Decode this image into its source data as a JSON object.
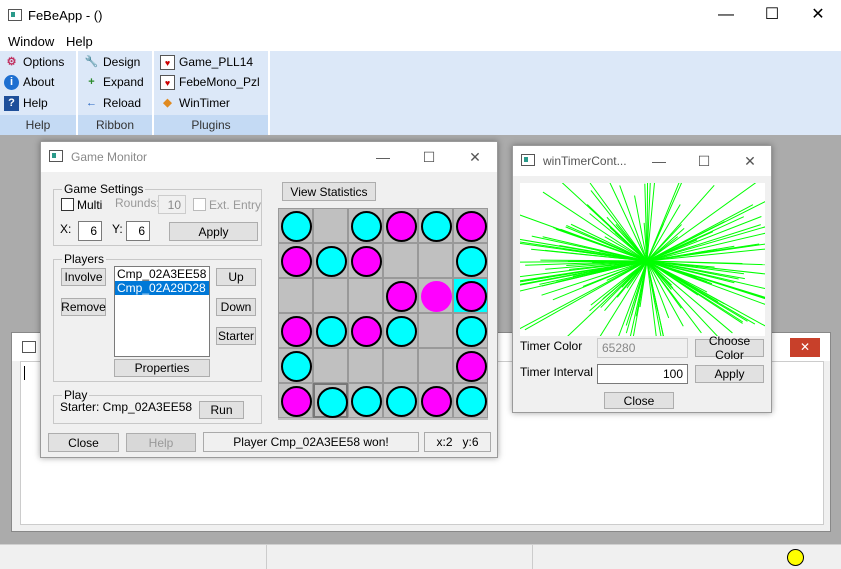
{
  "window": {
    "title": "FeBeApp -  ()",
    "minimize": "—",
    "maximize": "☐",
    "close": "✕"
  },
  "menu": {
    "window": "Window",
    "help": "Help"
  },
  "ribbon": {
    "groups": [
      {
        "label": "Help",
        "items": [
          "Options",
          "About",
          "Help"
        ]
      },
      {
        "label": "Ribbon",
        "items": [
          "Design",
          "Expand",
          "Reload"
        ]
      },
      {
        "label": "Plugins",
        "items": [
          "Game_PLL14",
          "FebeMono_Pzl",
          "WinTimer"
        ]
      }
    ]
  },
  "game_monitor": {
    "title": "Game Monitor",
    "view_statistics": "View Statistics",
    "settings": {
      "legend": "Game Settings",
      "multi": "Multi",
      "rounds_label": "Rounds:",
      "rounds": "10",
      "ext_entry": "Ext. Entry",
      "x_label": "X:",
      "x": "6",
      "y_label": "Y:",
      "y": "6",
      "apply": "Apply"
    },
    "players": {
      "legend": "Players",
      "involve": "Involve",
      "remove": "Remove",
      "list": [
        "Cmp_02A3EE58",
        "Cmp_02A29D28"
      ],
      "selected": 1,
      "up": "Up",
      "down": "Down",
      "starter": "Starter",
      "properties": "Properties"
    },
    "play": {
      "legend": "Play",
      "starter": "Starter: Cmp_02A3EE58",
      "run": "Run"
    },
    "close": "Close",
    "help": "Help",
    "status": "Player Cmp_02A3EE58 won!",
    "coords": "x:2   y:6",
    "board": [
      [
        "c",
        "e",
        "c",
        "m",
        "c",
        "m"
      ],
      [
        "m",
        "c",
        "m",
        "e",
        "e",
        "c"
      ],
      [
        "e",
        "e",
        "e",
        "m",
        "M",
        "m"
      ],
      [
        "m",
        "c",
        "m",
        "c",
        "e",
        "c"
      ],
      [
        "c",
        "e",
        "e",
        "e",
        "e",
        "m"
      ],
      [
        "m",
        "c",
        "c",
        "c",
        "m",
        "c"
      ]
    ],
    "colors": {
      "cyan": "#00ffff",
      "magenta": "#ff00ff",
      "board": "#c0c0c0"
    }
  },
  "win_timer": {
    "title": "winTimerCont...",
    "timer_color_label": "Timer Color",
    "timer_color": "65280",
    "choose_color": "Choose Color",
    "timer_interval_label": "Timer Interval",
    "timer_interval": "100",
    "apply": "Apply",
    "close": "Close",
    "line_color": "#00ff00"
  },
  "status_indicator_color": "#ffff00"
}
